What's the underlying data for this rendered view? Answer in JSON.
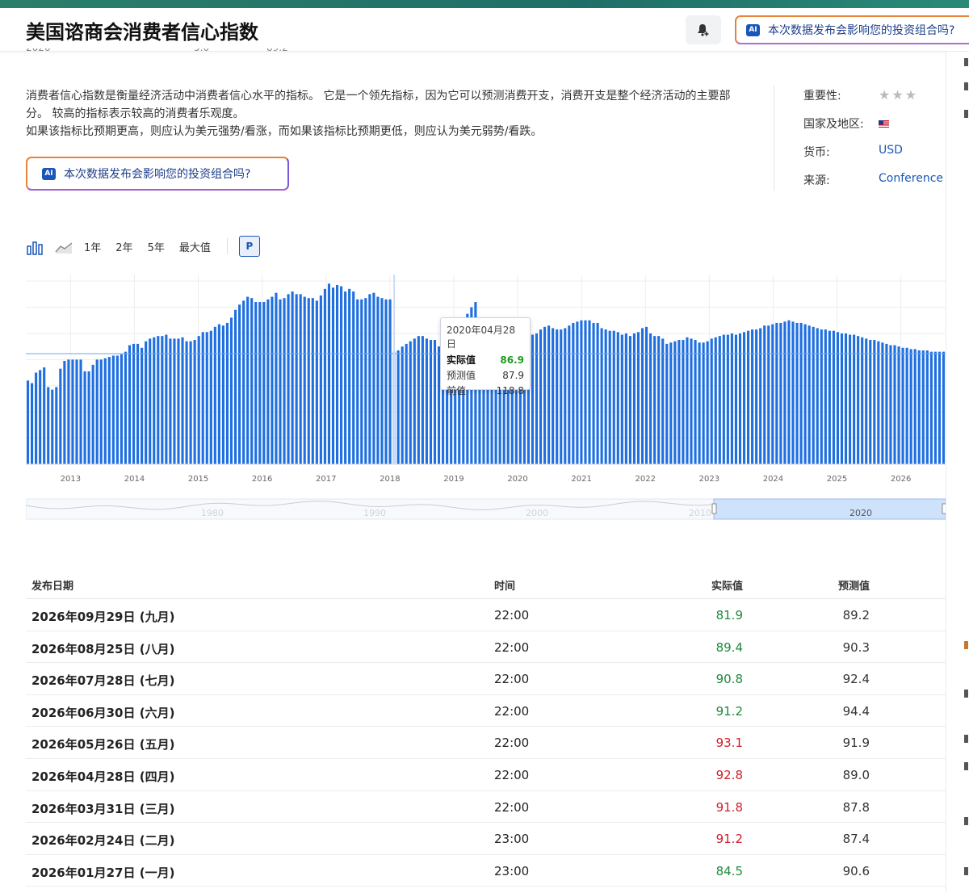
{
  "header": {
    "title": "美国谘商会消费者信心指数",
    "ai_button": "本次数据发布会影响您的投资组合吗?"
  },
  "description": {
    "line1": "消费者信心指数是衡量经济活动中消费者信心水平的指标。 它是一个领先指标，因为它可以预测消费开支，消费开支是整个经济活动的主要部分。 较高的指标表示较高的消费者乐观度。",
    "line2": "如果该指标比预期更高，则应认为美元强势/看涨，而如果该指标比预期更低，则应认为美元弱势/看跌。"
  },
  "ai_button_main": "本次数据发布会影响您的投资组合吗?",
  "meta": {
    "importance_label": "重要性:",
    "importance_stars": 3,
    "country_label": "国家及地区:",
    "currency_label": "货币:",
    "currency": "USD",
    "source_label": "来源:",
    "source": "Conference"
  },
  "toolbar": {
    "range_1y": "1年",
    "range_2y": "2年",
    "range_5y": "5年",
    "range_max": "最大值",
    "p_button": "P"
  },
  "chart_data": {
    "type": "bar",
    "x_tick_labels": [
      "2013",
      "2014",
      "2015",
      "2016",
      "2017",
      "2018",
      "2019",
      "2020",
      "2021",
      "2022",
      "2023",
      "2024",
      "2025",
      "2026"
    ],
    "x_range": [
      2012.3,
      2026.7
    ],
    "ylim": [
      0,
      145
    ],
    "grid": true,
    "series_color": "#1f6fe0",
    "navigator_labels": [
      "1980",
      "1990",
      "2000",
      "2010",
      "2020"
    ],
    "values": [
      64,
      62,
      70,
      72,
      74,
      59,
      57,
      59,
      73,
      79,
      80,
      80,
      80,
      80,
      71,
      71,
      76,
      80,
      80,
      81,
      82,
      83,
      83,
      84,
      86,
      91,
      92,
      92,
      89,
      94,
      96,
      97,
      98,
      98,
      99,
      96,
      96,
      96,
      97,
      94,
      94,
      95,
      98,
      101,
      101,
      102,
      105,
      107,
      106,
      108,
      112,
      118,
      122,
      125,
      128,
      127,
      124,
      124,
      124,
      126,
      128,
      131,
      126,
      127,
      130,
      132,
      130,
      130,
      128,
      127,
      127,
      125,
      129,
      134,
      138,
      135,
      137,
      136,
      132,
      134,
      132,
      126,
      126,
      127,
      130,
      131,
      128,
      127,
      126,
      126,
      86,
      87,
      90,
      92,
      94,
      96,
      98,
      98,
      96,
      95,
      95,
      90,
      88,
      89,
      90,
      92,
      96,
      104,
      115,
      120,
      124,
      112,
      108,
      106,
      108,
      110,
      108,
      104,
      104,
      102,
      102,
      103,
      100,
      100,
      99,
      100,
      103,
      105,
      106,
      104,
      103,
      103,
      104,
      106,
      108,
      109,
      110,
      110,
      110,
      108,
      108,
      104,
      103,
      102,
      102,
      101,
      99,
      100,
      98,
      100,
      101,
      104,
      105,
      100,
      98,
      98,
      96,
      92,
      93,
      94,
      95,
      95,
      97,
      96,
      95,
      93,
      93,
      94,
      96,
      97,
      98,
      99,
      99,
      100,
      99,
      100,
      101,
      102,
      103,
      103,
      104,
      106,
      106,
      107,
      108,
      108,
      109,
      110,
      109,
      108,
      108,
      107,
      106,
      105,
      104,
      103,
      103,
      102,
      102,
      101,
      100,
      100,
      99,
      99,
      98,
      97,
      96,
      95,
      95,
      94,
      93,
      92,
      91,
      91,
      90,
      89,
      89,
      88,
      88,
      87,
      87,
      87,
      86,
      86,
      86,
      86
    ],
    "tooltip": {
      "date": "2020年04月28日",
      "actual_label": "实际值",
      "actual": "86.9",
      "forecast_label": "预测值",
      "forecast": "87.9",
      "previous_label": "前值",
      "previous": "118.8"
    }
  },
  "table": {
    "headers": {
      "date": "发布日期",
      "time": "时间",
      "actual": "实际值",
      "forecast": "预测值"
    },
    "rows": [
      {
        "date": "2026年09月29日 (九月)",
        "time": "22:00",
        "actual": "81.9",
        "forecast": "89.2",
        "color": "#1e8a3a"
      },
      {
        "date": "2026年08月25日 (八月)",
        "time": "22:00",
        "actual": "89.4",
        "forecast": "90.3",
        "color": "#1e8a3a"
      },
      {
        "date": "2026年07月28日 (七月)",
        "time": "22:00",
        "actual": "90.8",
        "forecast": "92.4",
        "color": "#1e8a3a"
      },
      {
        "date": "2026年06月30日 (六月)",
        "time": "22:00",
        "actual": "91.2",
        "forecast": "94.4",
        "color": "#1e8a3a"
      },
      {
        "date": "2026年05月26日 (五月)",
        "time": "22:00",
        "actual": "93.1",
        "forecast": "91.9",
        "color": "#d0202a"
      },
      {
        "date": "2026年04月28日 (四月)",
        "time": "22:00",
        "actual": "92.8",
        "forecast": "89.0",
        "color": "#d0202a"
      },
      {
        "date": "2026年03月31日 (三月)",
        "time": "22:00",
        "actual": "91.8",
        "forecast": "87.8",
        "color": "#d0202a"
      },
      {
        "date": "2026年02月24日 (二月)",
        "time": "23:00",
        "actual": "91.2",
        "forecast": "87.4",
        "color": "#d0202a"
      },
      {
        "date": "2026年01月27日 (一月)",
        "time": "23:00",
        "actual": "84.5",
        "forecast": "90.6",
        "color": "#1e8a3a"
      }
    ]
  }
}
